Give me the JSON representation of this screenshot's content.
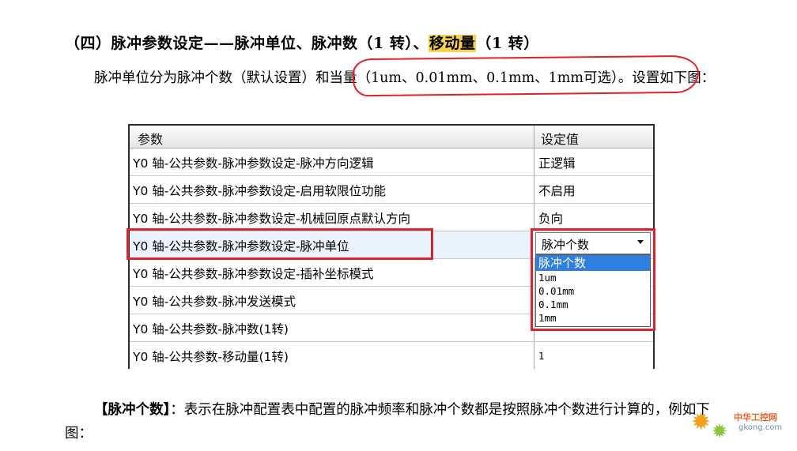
{
  "heading": {
    "prefix": "（四）脉冲参数设定——脉冲单位、脉冲数（1 转）、",
    "highlight": "移动量",
    "suffix": "（1 转）"
  },
  "para1": "脉冲单位分为脉冲个数（默认设置）和当量（1um、0.01mm、0.1mm、1mm可选）。设置如下图：",
  "table": {
    "header_param": "参数",
    "header_value": "设定值",
    "rows": [
      {
        "param": "Y0 轴-公共参数-脉冲参数设定-脉冲方向逻辑",
        "value": "正逻辑"
      },
      {
        "param": "Y0 轴-公共参数-脉冲参数设定-启用软限位功能",
        "value": "不启用"
      },
      {
        "param": "Y0 轴-公共参数-脉冲参数设定-机械回原点默认方向",
        "value": "负向"
      },
      {
        "param": "Y0 轴-公共参数-脉冲参数设定-脉冲单位",
        "value": ""
      },
      {
        "param": "Y0 轴-公共参数-脉冲参数设定-插补坐标模式",
        "value": ""
      },
      {
        "param": "Y0 轴-公共参数-脉冲发送模式",
        "value": ""
      },
      {
        "param": "Y0 轴-公共参数-脉冲数(1转)",
        "value": ""
      },
      {
        "param": "Y0 轴-公共参数-移动量(1转)",
        "value": "1"
      }
    ]
  },
  "dropdown": {
    "selected": "脉冲个数",
    "options": [
      "脉冲个数",
      "1um",
      "0.01mm",
      "0.1mm",
      "1mm"
    ]
  },
  "para2": {
    "bold": "【脉冲个数】",
    "text": "：表示在脉冲配置表中配置的脉冲频率和脉冲个数都是按照脉冲个数进行计算的，例如下图："
  },
  "watermark": {
    "cn": "中华工控网",
    "en": "gkong.com"
  },
  "colors": {
    "highlight": "#f7d24a",
    "annotation_red": "#d9232d",
    "selection_blue": "#2f7fe0"
  }
}
